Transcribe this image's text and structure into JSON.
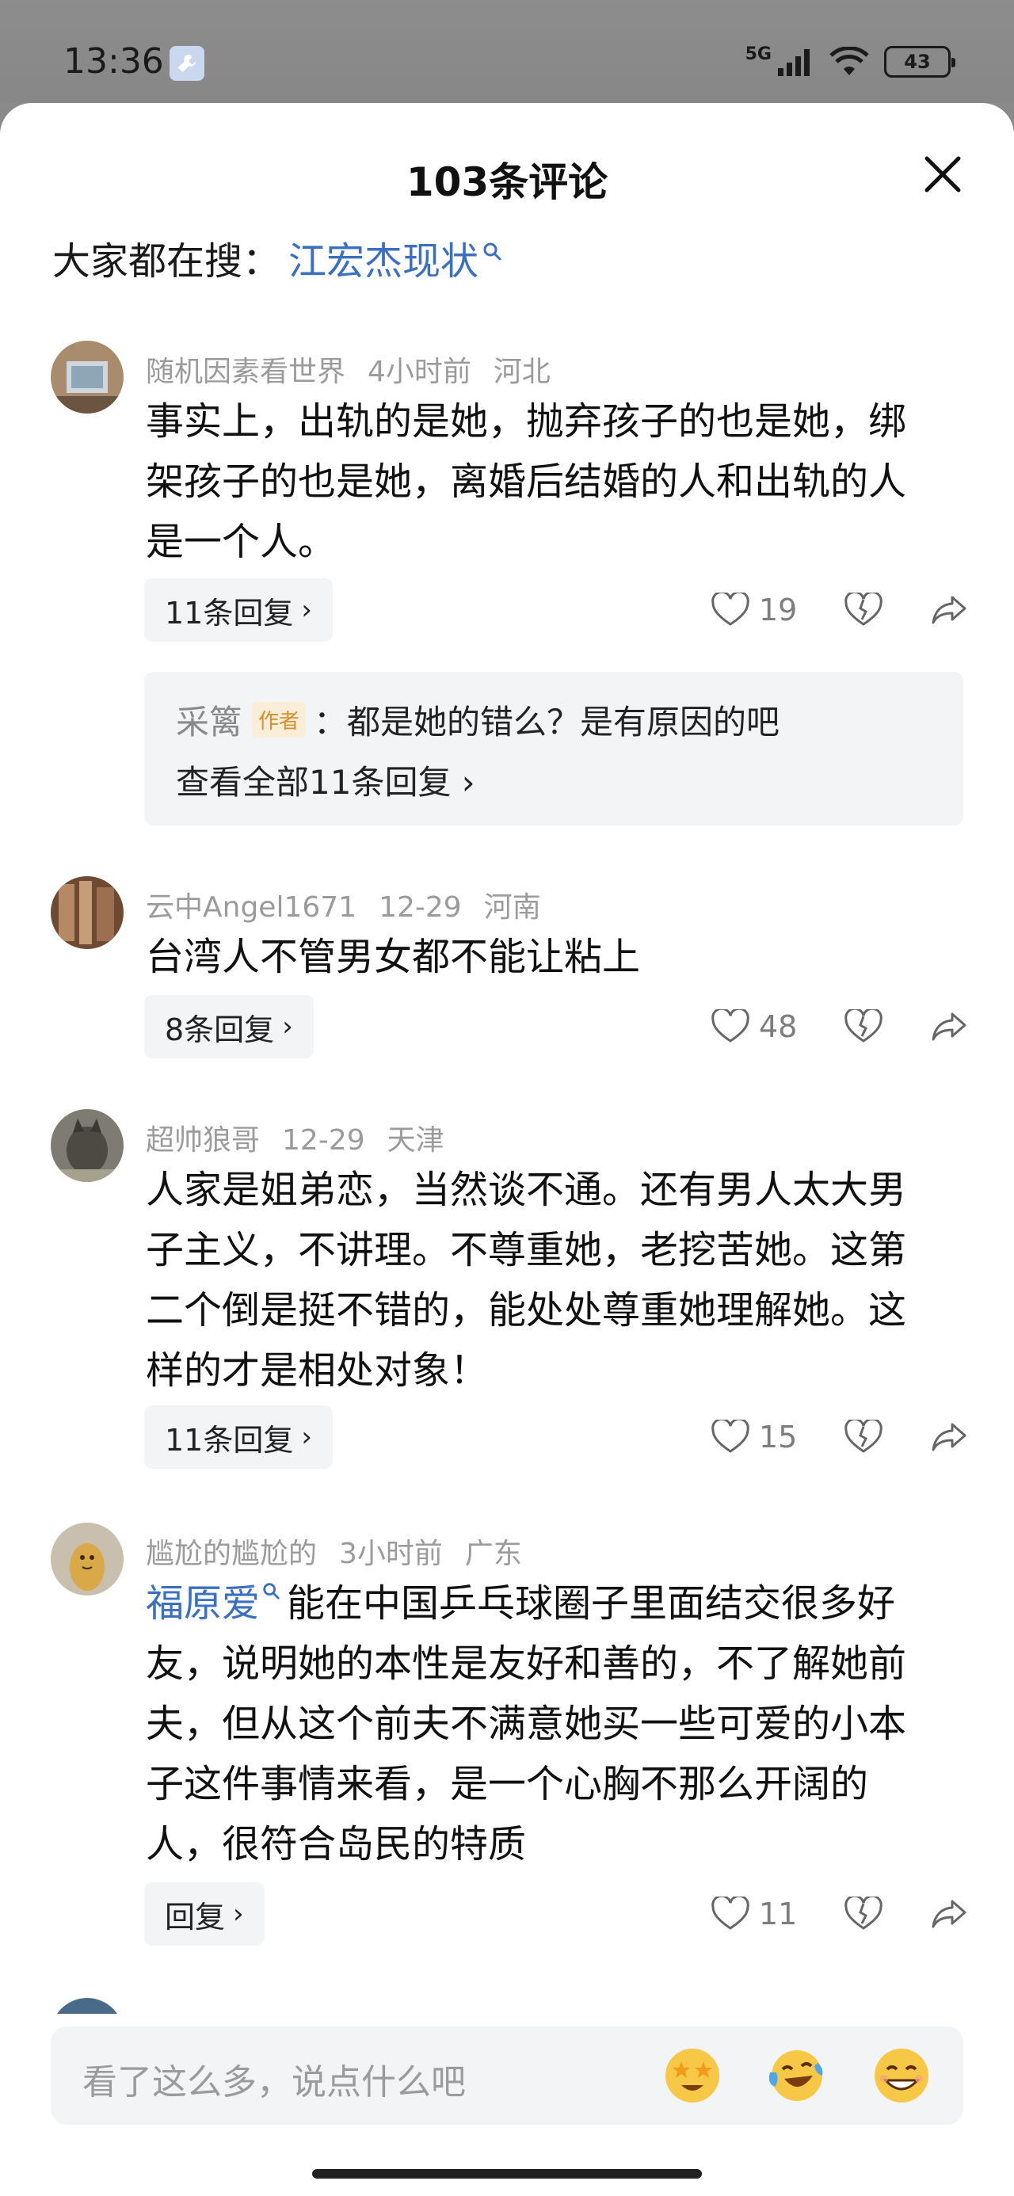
{
  "status_bar": {
    "time": "13:36",
    "network": "5G",
    "battery": "43"
  },
  "sheet": {
    "title": "103条评论",
    "search_hint_label": "大家都在搜：",
    "search_hint_link": "江宏杰现状"
  },
  "comments": [
    {
      "user": "随机因素看世界",
      "time": "4小时前",
      "location": "河北",
      "text": "事实上，出轨的是她，抛弃孩子的也是她，绑架孩子的也是她，离婚后结婚的人和出轨的人是一个人。",
      "replies_label": "11条回复",
      "likes": "19",
      "sub_reply": {
        "author": "采篱",
        "badge": "作者",
        "text": "：都是她的错么？是有原因的吧",
        "view_all": "查看全部11条回复 ›"
      }
    },
    {
      "user": "云中Angel1671",
      "time": "12-29",
      "location": "河南",
      "text": "台湾人不管男女都不能让粘上",
      "replies_label": "8条回复",
      "likes": "48"
    },
    {
      "user": "超帅狼哥",
      "time": "12-29",
      "location": "天津",
      "text": "人家是姐弟恋，当然谈不通。还有男人太大男子主义，不讲理。不尊重她，老挖苦她。这第二个倒是挺不错的，能处处尊重她理解她。这样的才是相处对象！",
      "replies_label": "11条回复",
      "likes": "15"
    },
    {
      "user": "尴尬的尴尬的",
      "time": "3小时前",
      "location": "广东",
      "link": "福原爱",
      "text": "能在中国乒乓球圈子里面结交很多好友，说明她的本性是友好和善的，不了解她前夫，但从这个前夫不满意她买一些可爱的小本子这件事情来看，是一个心胸不那么开阔的人，很符合岛民的特质",
      "replies_label": "回复",
      "likes": "11"
    }
  ],
  "input": {
    "placeholder": "看了这么多，说点什么吧"
  },
  "icons": {
    "wrench": "wrench-icon",
    "close": "close-icon",
    "like": "heart-icon",
    "dislike": "broken-heart-icon",
    "share": "share-icon"
  },
  "colors": {
    "link": "#3a6fc2",
    "meta": "#9b9b9b",
    "badge": "#d98d2c"
  }
}
